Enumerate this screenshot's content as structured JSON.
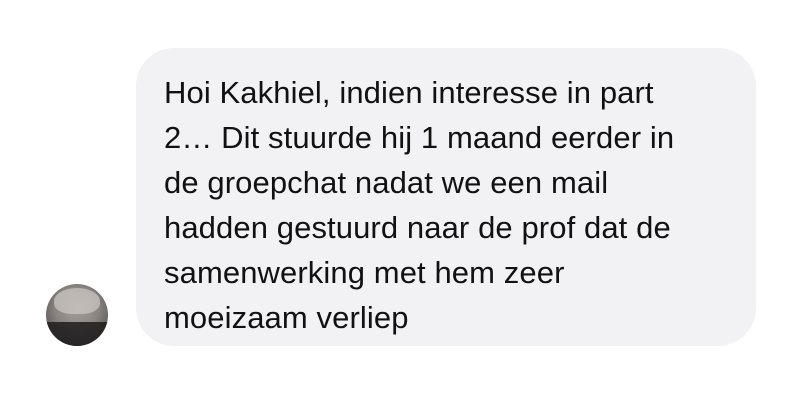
{
  "conversation": {
    "messages": [
      {
        "avatar_icon": "user-avatar-blurred",
        "text": "Hoi Kakhiel, indien interesse in part\n2… Dit stuurde hij 1 maand eerder in\nde groepchat nadat we een mail\nhadden gestuurd naar de prof dat de\nsamenwerking met hem zeer\nmoeizaam verliep"
      }
    ]
  },
  "colors": {
    "bubble_background": "#f2f2f4",
    "text": "#111111",
    "page_background": "#ffffff"
  }
}
